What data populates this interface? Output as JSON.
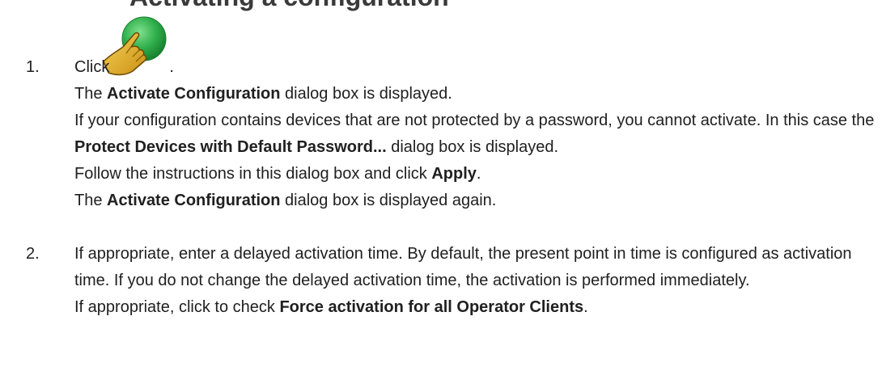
{
  "heading_fragment": "Activating a configuration",
  "step1": {
    "number": "1.",
    "click_text": "Click",
    "click_suffix": ".",
    "icon": "activate-hand-icon",
    "l2_a": "The ",
    "l2_bold": "Activate Configuration",
    "l2_b": " dialog box is displayed.",
    "l3_a": "If your configuration contains devices that are not protected by a password, you cannot activate. In this case the ",
    "l3_bold": "Protect Devices with Default Password...",
    "l3_b": " dialog box is displayed.",
    "l4_a": "Follow the instructions in this dialog box and click ",
    "l4_bold": "Apply",
    "l4_b": ".",
    "l5_a": "The ",
    "l5_bold": "Activate Configuration",
    "l5_b": " dialog box is displayed again."
  },
  "step2": {
    "number": "2.",
    "p1": "If appropriate, enter a delayed activation time. By default, the present point in time is configured as activation time. If you do not change the delayed activation time, the activation is performed immediately.",
    "l2_a": "If appropriate, click to check ",
    "l2_bold": "Force activation for all Operator Clients",
    "l2_b": "."
  },
  "colors": {
    "icon_green": "#2eae4a",
    "icon_hand": "#e8b62a",
    "text": "#202020"
  }
}
